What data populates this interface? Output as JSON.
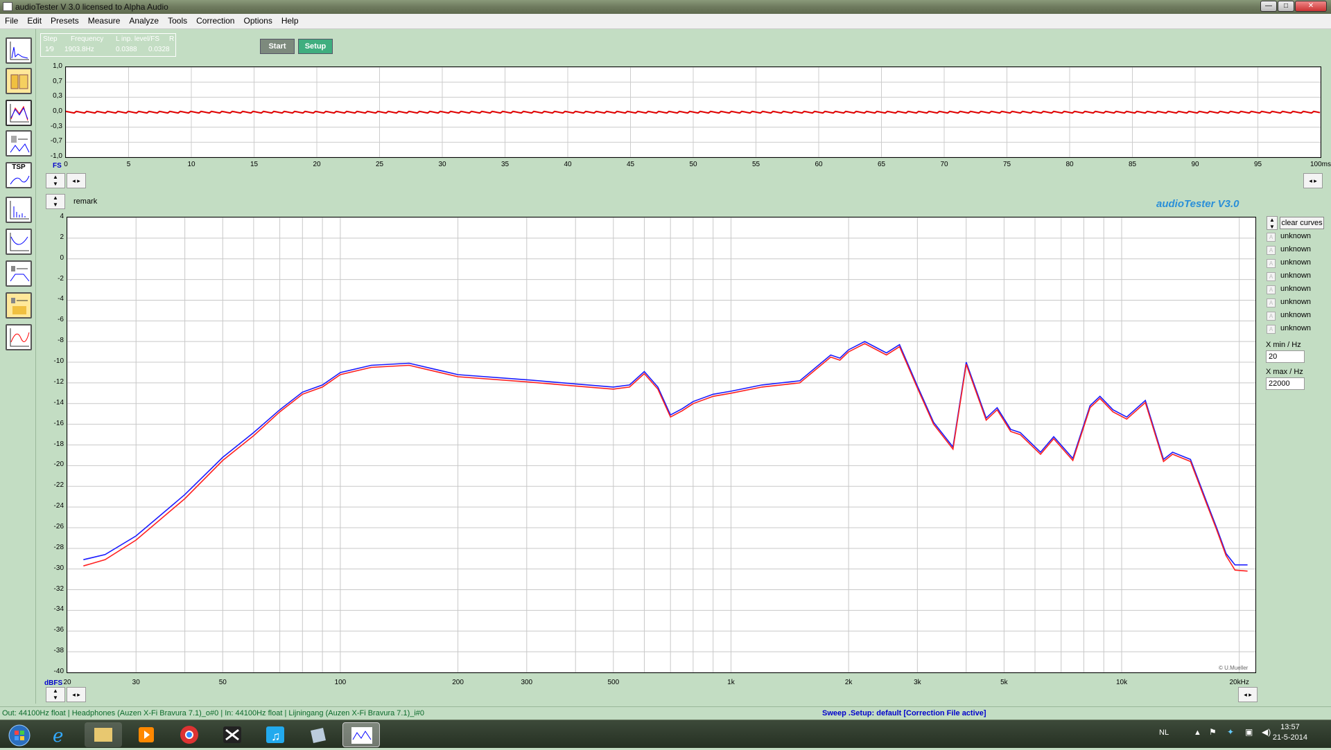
{
  "window": {
    "title": "audioTester  V 3.0   licensed to Alpha Audio"
  },
  "menu": [
    "File",
    "Edit",
    "Presets",
    "Measure",
    "Analyze",
    "Tools",
    "Correction",
    "Options",
    "Help"
  ],
  "readout": {
    "labels": [
      "Step",
      "Frequency",
      "L  inp. level/FS",
      "R"
    ],
    "values": [
      "1⁄9",
      "1903.8Hz",
      "0.0388",
      "0.0328"
    ]
  },
  "buttons": {
    "start": "Start",
    "setup": "Setup",
    "clear": "clear curves"
  },
  "remark": "remark",
  "brand": "audioTester  V3.0",
  "copyright": "© U.Mueller",
  "top_plot": {
    "y_ticks": [
      "1,0",
      "0,7",
      "0,3",
      "0,0",
      "-0,3",
      "-0,7",
      "-1,0"
    ],
    "x_ticks": [
      "0",
      "5",
      "10",
      "15",
      "20",
      "25",
      "30",
      "35",
      "40",
      "45",
      "50",
      "55",
      "60",
      "65",
      "70",
      "75",
      "80",
      "85",
      "90",
      "95",
      "100ms"
    ],
    "y_unit": "FS"
  },
  "legend": {
    "items": [
      "unknown",
      "unknown",
      "unknown",
      "unknown",
      "unknown",
      "unknown",
      "unknown",
      "unknown"
    ]
  },
  "xrange": {
    "min_label": "X min / Hz",
    "min_value": "20",
    "max_label": "X max / Hz",
    "max_value": "22000"
  },
  "status": {
    "left": "Out: 44100Hz float  | Headphones (Auzen X-Fi Bravura 7.1)_o#0  | In: 44100Hz float  | Lijningang (Auzen X-Fi Bravura 7.1)_i#0",
    "right": "Sweep  .Setup:  default  [Correction File active]"
  },
  "taskbar": {
    "lang": "NL",
    "time": "13:57",
    "date": "21-5-2014"
  },
  "chart_data": {
    "type": "line",
    "ylabel": "dBFS",
    "x_scale": "log",
    "xlim": [
      20,
      22000
    ],
    "ylim": [
      -40,
      4
    ],
    "x_ticks": [
      {
        "v": 20,
        "l": "20"
      },
      {
        "v": 30,
        "l": "30"
      },
      {
        "v": 50,
        "l": "50"
      },
      {
        "v": 100,
        "l": "100"
      },
      {
        "v": 200,
        "l": "200"
      },
      {
        "v": 300,
        "l": "300"
      },
      {
        "v": 500,
        "l": "500"
      },
      {
        "v": 1000,
        "l": "1k"
      },
      {
        "v": 2000,
        "l": "2k"
      },
      {
        "v": 3000,
        "l": "3k"
      },
      {
        "v": 5000,
        "l": "5k"
      },
      {
        "v": 10000,
        "l": "10k"
      },
      {
        "v": 20000,
        "l": "20kHz"
      }
    ],
    "y_ticks": [
      4,
      2,
      0,
      -2,
      -4,
      -6,
      -8,
      -10,
      -12,
      -14,
      -16,
      -18,
      -20,
      -22,
      -24,
      -26,
      -28,
      -30,
      -32,
      -34,
      -36,
      -38,
      -40
    ],
    "series": [
      {
        "color": "#1a1aff",
        "x": [
          22,
          25,
          30,
          40,
          50,
          60,
          70,
          80,
          90,
          100,
          120,
          150,
          200,
          300,
          400,
          500,
          550,
          600,
          650,
          700,
          750,
          800,
          900,
          1000,
          1200,
          1500,
          1800,
          1900,
          2000,
          2200,
          2500,
          2700,
          3000,
          3300,
          3700,
          4000,
          4500,
          4800,
          5200,
          5500,
          6200,
          6700,
          7500,
          8300,
          8800,
          9500,
          10300,
          11500,
          12800,
          13500,
          15000,
          16500,
          17500,
          18500,
          19500,
          21000
        ],
        "y": [
          -29.1,
          -28.6,
          -26.8,
          -22.8,
          -19.2,
          -16.8,
          -14.6,
          -12.9,
          -12.2,
          -11.0,
          -10.3,
          -10.1,
          -11.2,
          -11.7,
          -12.1,
          -12.4,
          -12.2,
          -10.9,
          -12.4,
          -15.1,
          -14.5,
          -13.8,
          -13.1,
          -12.8,
          -12.2,
          -11.8,
          -9.3,
          -9.6,
          -8.8,
          -8.0,
          -9.1,
          -8.3,
          -12.3,
          -15.8,
          -18.2,
          -10.0,
          -15.4,
          -14.4,
          -16.5,
          -16.8,
          -18.7,
          -17.2,
          -19.3,
          -14.2,
          -13.3,
          -14.6,
          -15.3,
          -13.7,
          -19.4,
          -18.7,
          -19.4,
          -23.5,
          -26.0,
          -28.5,
          -29.6,
          -29.6
        ]
      },
      {
        "color": "#ff2020",
        "x": [
          22,
          25,
          30,
          40,
          50,
          60,
          70,
          80,
          90,
          100,
          120,
          150,
          200,
          300,
          400,
          500,
          550,
          600,
          650,
          700,
          750,
          800,
          900,
          1000,
          1200,
          1500,
          1800,
          1900,
          2000,
          2200,
          2500,
          2700,
          3000,
          3300,
          3700,
          4000,
          4500,
          4800,
          5200,
          5500,
          6200,
          6700,
          7500,
          8300,
          8800,
          9500,
          10300,
          11500,
          12800,
          13500,
          15000,
          16500,
          17500,
          18500,
          19500,
          21000
        ],
        "y": [
          -29.7,
          -29.1,
          -27.2,
          -23.2,
          -19.5,
          -17.1,
          -14.8,
          -13.1,
          -12.4,
          -11.2,
          -10.5,
          -10.3,
          -11.4,
          -11.9,
          -12.3,
          -12.6,
          -12.4,
          -11.1,
          -12.6,
          -15.3,
          -14.7,
          -14.0,
          -13.3,
          -13.0,
          -12.4,
          -12.0,
          -9.5,
          -9.8,
          -9.0,
          -8.2,
          -9.3,
          -8.5,
          -12.5,
          -16.0,
          -18.4,
          -10.2,
          -15.6,
          -14.6,
          -16.7,
          -17.0,
          -18.9,
          -17.4,
          -19.5,
          -14.4,
          -13.5,
          -14.8,
          -15.5,
          -13.9,
          -19.6,
          -18.9,
          -19.6,
          -23.7,
          -26.2,
          -28.7,
          -30.1,
          -30.2
        ]
      }
    ]
  }
}
